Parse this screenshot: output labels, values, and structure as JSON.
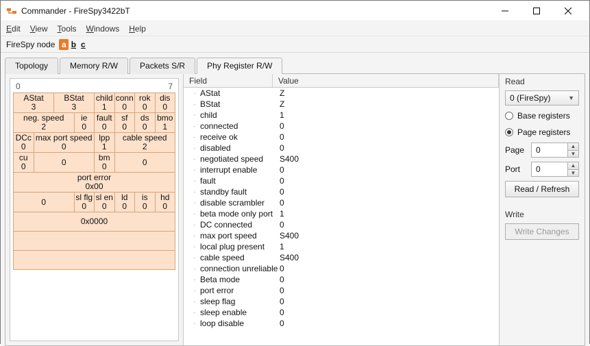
{
  "window": {
    "title": "Commander - FireSpy3422bT"
  },
  "menu": {
    "edit": "Edit",
    "view": "View",
    "tools": "Tools",
    "windows": "Windows",
    "help": "Help"
  },
  "nodebar": {
    "label": "FireSpy node",
    "nodes": [
      {
        "id": "a",
        "label": "a",
        "active": true
      },
      {
        "id": "b",
        "label": "b",
        "active": false
      },
      {
        "id": "c",
        "label": "c",
        "active": false
      }
    ]
  },
  "tabs": {
    "items": [
      {
        "label": "Topology"
      },
      {
        "label": "Memory R/W"
      },
      {
        "label": "Packets S/R"
      },
      {
        "label": "Phy Register R/W"
      }
    ],
    "active": 3
  },
  "bitmap": {
    "idx_left": "0",
    "idx_right": "7",
    "rows": [
      [
        {
          "h": "AStat",
          "v": "3",
          "span": 2
        },
        {
          "h": "BStat",
          "v": "3",
          "span": 2
        },
        {
          "h": "child",
          "v": "1"
        },
        {
          "h": "conn",
          "v": "0"
        },
        {
          "h": "rok",
          "v": "0"
        },
        {
          "h": "dis",
          "v": "0"
        }
      ],
      [
        {
          "h": "neg. speed",
          "v": "2",
          "span": 3
        },
        {
          "h": "ie",
          "v": "0"
        },
        {
          "h": "fault",
          "v": "0"
        },
        {
          "h": "sf",
          "v": "0"
        },
        {
          "h": "ds",
          "v": "0"
        },
        {
          "h": "bmo",
          "v": "1"
        }
      ],
      [
        {
          "h": "DCc",
          "v": "0"
        },
        {
          "h": "max port speed",
          "v": "0",
          "span": 3
        },
        {
          "h": "lpp",
          "v": "1"
        },
        {
          "h": "cable speed",
          "v": "2",
          "span": 3
        }
      ],
      [
        {
          "h": "cu",
          "v": "0"
        },
        {
          "h": "",
          "v": "0",
          "span": 3
        },
        {
          "h": "bm",
          "v": "0"
        },
        {
          "h": "",
          "v": "0",
          "span": 3
        }
      ],
      [
        {
          "h": "port error",
          "v": "0x00",
          "span": 8
        }
      ],
      [
        {
          "h": "",
          "v": "0",
          "span": 3
        },
        {
          "h": "sl flg",
          "v": "0"
        },
        {
          "h": "sl en",
          "v": "0"
        },
        {
          "h": "ld",
          "v": "0"
        },
        {
          "h": "is",
          "v": "0"
        },
        {
          "h": "hd",
          "v": "0"
        }
      ],
      [
        {
          "h": "",
          "v": "0x0000",
          "span": 8
        }
      ],
      [
        {
          "h": "",
          "v": "",
          "span": 8
        }
      ],
      [
        {
          "h": "",
          "v": "",
          "span": 8
        }
      ]
    ]
  },
  "fields": {
    "header": {
      "field": "Field",
      "value": "Value"
    },
    "rows": [
      {
        "field": "AStat",
        "value": "Z"
      },
      {
        "field": "BStat",
        "value": "Z"
      },
      {
        "field": "child",
        "value": "1"
      },
      {
        "field": "connected",
        "value": "0"
      },
      {
        "field": "receive ok",
        "value": "0"
      },
      {
        "field": "disabled",
        "value": "0"
      },
      {
        "field": "negotiated speed",
        "value": "S400"
      },
      {
        "field": "interrupt enable",
        "value": "0"
      },
      {
        "field": "fault",
        "value": "0"
      },
      {
        "field": "standby fault",
        "value": "0"
      },
      {
        "field": "disable scrambler",
        "value": "0"
      },
      {
        "field": "beta mode only port",
        "value": "1"
      },
      {
        "field": "DC connected",
        "value": "0"
      },
      {
        "field": "max port speed",
        "value": "S400"
      },
      {
        "field": "local plug present",
        "value": "1"
      },
      {
        "field": "cable speed",
        "value": "S400"
      },
      {
        "field": "connection unreliable",
        "value": "0"
      },
      {
        "field": "Beta mode",
        "value": "0"
      },
      {
        "field": "port error",
        "value": "0"
      },
      {
        "field": "sleep flag",
        "value": "0"
      },
      {
        "field": "sleep enable",
        "value": "0"
      },
      {
        "field": "loop disable",
        "value": "0"
      }
    ]
  },
  "right": {
    "read_label": "Read",
    "device_selected": "0 (FireSpy)",
    "radio_base": "Base registers",
    "radio_page": "Page registers",
    "page_label": "Page",
    "page_value": "0",
    "port_label": "Port",
    "port_value": "0",
    "read_btn": "Read / Refresh",
    "write_label": "Write",
    "write_btn": "Write Changes"
  }
}
